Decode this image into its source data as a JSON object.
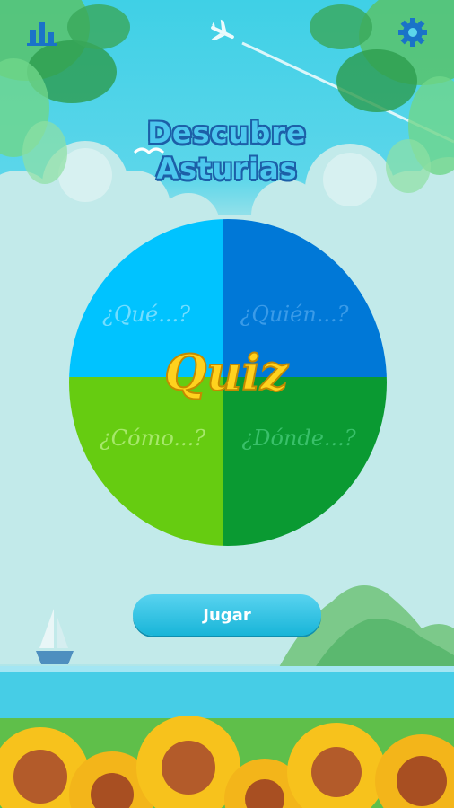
{
  "app": {
    "title_line1": "Descubre",
    "title_line2": "Asturias"
  },
  "toolbar": {
    "stats_icon": "bar-chart-icon",
    "settings_icon": "gear-icon"
  },
  "wheel": {
    "center_label": "Quiz",
    "quadrants": [
      {
        "label": "¿Qué...?",
        "color": "#00c3ff"
      },
      {
        "label": "¿Quién...?",
        "color": "#0078d7"
      },
      {
        "label": "¿Cómo...?",
        "color": "#66cc11"
      },
      {
        "label": "¿Dónde...?",
        "color": "#0a9a32"
      }
    ],
    "center_color": "#ffd21e"
  },
  "actions": {
    "play_label": "Jugar"
  },
  "colors": {
    "sky": "#3fd0e6",
    "accent": "#1ab6d9"
  }
}
